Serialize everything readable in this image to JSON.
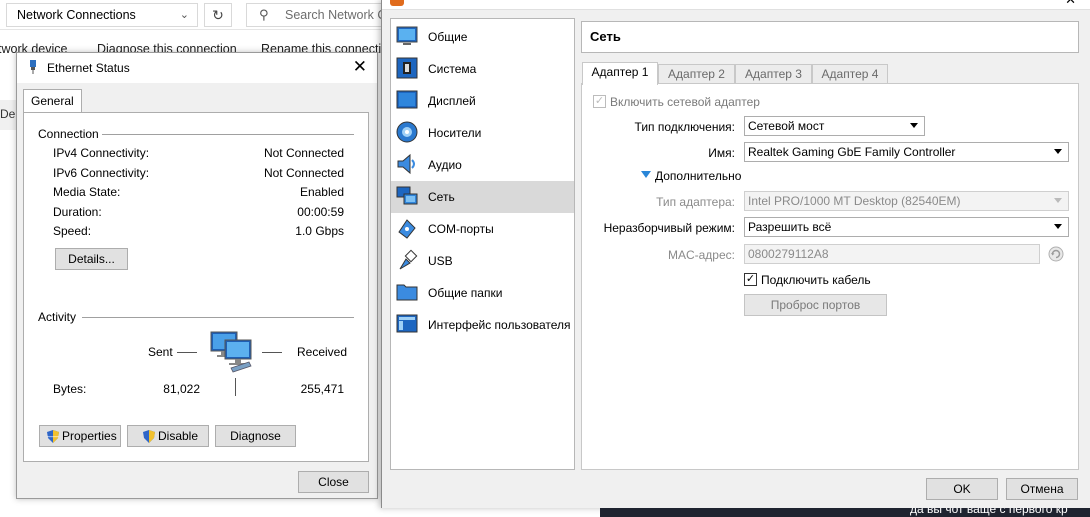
{
  "explorer": {
    "address": "Network Connections",
    "search_placeholder": "Search Network C",
    "cmd_left": "twork device",
    "cmd_diagnose": "Diagnose this connection",
    "cmd_rename": "Rename this connecti",
    "list_fragment": "De"
  },
  "eth": {
    "title": "Ethernet Status",
    "tab": "General",
    "connection_group": "Connection",
    "rows": [
      {
        "label": "IPv4 Connectivity:",
        "value": "Not Connected"
      },
      {
        "label": "IPv6 Connectivity:",
        "value": "Not Connected"
      },
      {
        "label": "Media State:",
        "value": "Enabled"
      },
      {
        "label": "Duration:",
        "value": "00:00:59"
      },
      {
        "label": "Speed:",
        "value": "1.0 Gbps"
      }
    ],
    "details_btn": "Details...",
    "activity_group": "Activity",
    "sent_label": "Sent",
    "received_label": "Received",
    "bytes_label": "Bytes:",
    "bytes_sent": "81,022",
    "bytes_received": "255,471",
    "properties_btn": "Properties",
    "disable_btn": "Disable",
    "diagnose_btn": "Diagnose",
    "close_btn": "Close"
  },
  "vbox": {
    "nav": [
      {
        "label": "Общие",
        "icon": "general-icon"
      },
      {
        "label": "Система",
        "icon": "system-icon"
      },
      {
        "label": "Дисплей",
        "icon": "display-icon"
      },
      {
        "label": "Носители",
        "icon": "storage-icon"
      },
      {
        "label": "Аудио",
        "icon": "audio-icon"
      },
      {
        "label": "Сеть",
        "icon": "network-icon"
      },
      {
        "label": "COM-порты",
        "icon": "serial-ports-icon"
      },
      {
        "label": "USB",
        "icon": "usb-icon"
      },
      {
        "label": "Общие папки",
        "icon": "shared-folders-icon"
      },
      {
        "label": "Интерфейс пользователя",
        "icon": "user-interface-icon"
      }
    ],
    "selected_nav": "Сеть",
    "section_title": "Сеть",
    "tabs": [
      "Адаптер 1",
      "Адаптер 2",
      "Адаптер 3",
      "Адаптер 4"
    ],
    "enable_adapter": "Включить сетевой адаптер",
    "attached_label": "Тип подключения:",
    "attached_value": "Сетевой мост",
    "name_label": "Имя:",
    "name_value": "Realtek Gaming GbE Family Controller",
    "advanced": "Дополнительно",
    "adapter_type_label": "Тип адаптера:",
    "adapter_type_value": "Intel PRO/1000 MT Desktop (82540EM)",
    "promisc_label": "Неразборчивый режим:",
    "promisc_value": "Разрешить всё",
    "mac_label": "MAC-адрес:",
    "mac_value": "0800279112A8",
    "cable_label": "Подключить кабель",
    "port_fwd_btn": "Проброс портов",
    "ok_btn": "OK",
    "cancel_btn": "Отмена"
  },
  "taskbar_text": "да вы чот ваще с первого кр"
}
